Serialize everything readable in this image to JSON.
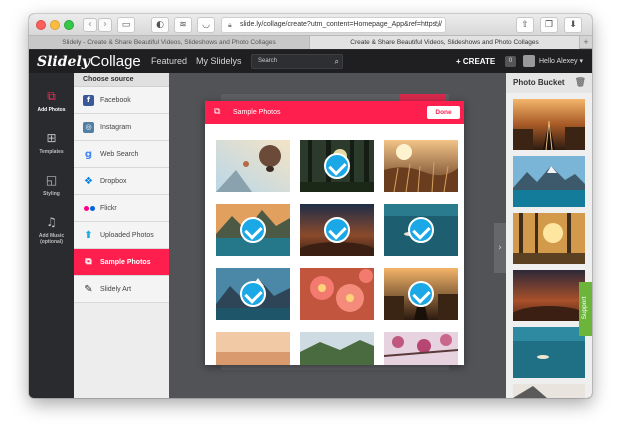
{
  "browser": {
    "url": "slide.ly/collage/create?utm_content=Homepage_App&ref=https://",
    "tabs": [
      {
        "label": "Slidely - Create & Share Beautiful Videos, Slideshows and Photo Collages"
      },
      {
        "label": "Create & Share Beautiful Videos, Slideshows and Photo Collages"
      }
    ]
  },
  "header": {
    "logo_bold": "Slidely",
    "logo_light": "Collage",
    "nav": [
      "Featured",
      "My Slidelys"
    ],
    "search_placeholder": "Search",
    "create_label": "+ CREATE",
    "badge_count": "0",
    "user_label": "Hello Alexey ▾"
  },
  "iconbar": {
    "items": [
      {
        "label": "Add Photos",
        "icon": "add-photos-icon",
        "active": true
      },
      {
        "label": "Templates",
        "icon": "templates-icon"
      },
      {
        "label": "Styling",
        "icon": "styling-icon"
      },
      {
        "label": "Add Music (optional)",
        "icon": "music-icon"
      }
    ]
  },
  "sources": {
    "title": "Choose source",
    "items": [
      {
        "label": "Facebook",
        "icon": "facebook-icon",
        "color": "#3b5998"
      },
      {
        "label": "Instagram",
        "icon": "instagram-icon",
        "color": "#517fa4"
      },
      {
        "label": "Web Search",
        "icon": "google-icon",
        "color": "#4285f4"
      },
      {
        "label": "Dropbox",
        "icon": "dropbox-icon",
        "color": "#007ee5"
      },
      {
        "label": "Flickr",
        "icon": "flickr-icon",
        "color": "#ff0084"
      },
      {
        "label": "Uploaded Photos",
        "icon": "upload-icon",
        "color": "#1aa9e6"
      },
      {
        "label": "Sample Photos",
        "icon": "sample-photos-icon",
        "active": true
      },
      {
        "label": "Slidely Art",
        "icon": "brush-icon",
        "color": "#333333"
      }
    ]
  },
  "modal": {
    "title": "Sample Photos",
    "done_label": "Done",
    "photos": [
      {
        "name": "balloons",
        "selected": false
      },
      {
        "name": "forest-sun",
        "selected": true
      },
      {
        "name": "wheat-field",
        "selected": false
      },
      {
        "name": "mountain-lake",
        "selected": true
      },
      {
        "name": "desert-dusk",
        "selected": true
      },
      {
        "name": "boat-lake",
        "selected": true
      },
      {
        "name": "snowy-peaks",
        "selected": true
      },
      {
        "name": "pink-flowers",
        "selected": false
      },
      {
        "name": "railway-tracks",
        "selected": true
      },
      {
        "name": "sunset-sky",
        "selected": false
      },
      {
        "name": "green-valley",
        "selected": false
      },
      {
        "name": "cherry-blossom",
        "selected": false
      }
    ]
  },
  "bucket": {
    "title": "Photo Bucket",
    "photos": [
      "railway-tracks",
      "mountain-lake",
      "forest-sun",
      "desert-dusk",
      "boat-lake",
      "snowy-peaks"
    ]
  },
  "support_label": "Support",
  "colors": {
    "accent": "#ff1f4e",
    "check": "#1aa9e6",
    "support": "#6bb53a"
  }
}
